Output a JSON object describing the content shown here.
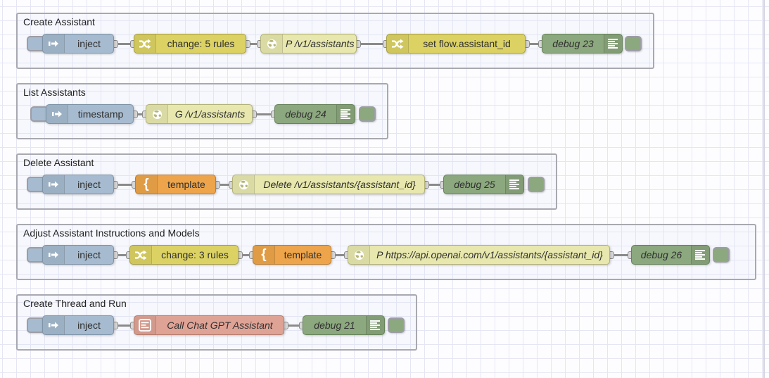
{
  "app": "node-red-flow-editor",
  "palette": {
    "inject": "#a6bbcf",
    "change": "#dcd264",
    "http_request": "#e7e7ae",
    "template": "#eda44a",
    "debug": "#8ca87e",
    "subflow": "#dfa396",
    "wire": "#8a8a8a",
    "group_border": "#a8a8b0",
    "grid_line": "#e5e6f3"
  },
  "groups": [
    {
      "title": "Create Assistant",
      "nodes": [
        {
          "label": "inject",
          "type": "inject",
          "icon": "inject-arrow-icon"
        },
        {
          "label": "change: 5 rules",
          "type": "change",
          "icon": "shuffle-icon"
        },
        {
          "label": "P /v1/assistants",
          "type": "http request",
          "icon": "globe-icon"
        },
        {
          "label": "set flow.assistant_id",
          "type": "change",
          "icon": "shuffle-icon"
        },
        {
          "label": "debug 23",
          "type": "debug",
          "icon": "debug-list-icon"
        }
      ]
    },
    {
      "title": "List Assistants",
      "nodes": [
        {
          "label": "timestamp",
          "type": "inject",
          "icon": "inject-arrow-icon"
        },
        {
          "label": "G /v1/assistants",
          "type": "http request",
          "icon": "globe-icon"
        },
        {
          "label": "debug 24",
          "type": "debug",
          "icon": "debug-list-icon"
        }
      ]
    },
    {
      "title": "Delete Assistant",
      "nodes": [
        {
          "label": "inject",
          "type": "inject",
          "icon": "inject-arrow-icon"
        },
        {
          "label": "template",
          "type": "template",
          "icon": "curly-brace-icon"
        },
        {
          "label": "Delete /v1/assistants/{assistant_id}",
          "type": "http request",
          "icon": "globe-icon"
        },
        {
          "label": "debug 25",
          "type": "debug",
          "icon": "debug-list-icon"
        }
      ]
    },
    {
      "title": "Adjust Assistant Instructions and Models",
      "nodes": [
        {
          "label": "inject",
          "type": "inject",
          "icon": "inject-arrow-icon"
        },
        {
          "label": "change: 3 rules",
          "type": "change",
          "icon": "shuffle-icon"
        },
        {
          "label": "template",
          "type": "template",
          "icon": "curly-brace-icon"
        },
        {
          "label": "P https://api.openai.com/v1/assistants/{assistant_id}",
          "type": "http request",
          "icon": "globe-icon"
        },
        {
          "label": "debug 26",
          "type": "debug",
          "icon": "debug-list-icon"
        }
      ]
    },
    {
      "title": "Create Thread and Run",
      "nodes": [
        {
          "label": "inject",
          "type": "inject",
          "icon": "inject-arrow-icon"
        },
        {
          "label": "Call Chat GPT Assistant",
          "type": "subflow",
          "icon": "subflow-icon"
        },
        {
          "label": "debug 21",
          "type": "debug",
          "icon": "debug-list-icon"
        }
      ]
    }
  ]
}
